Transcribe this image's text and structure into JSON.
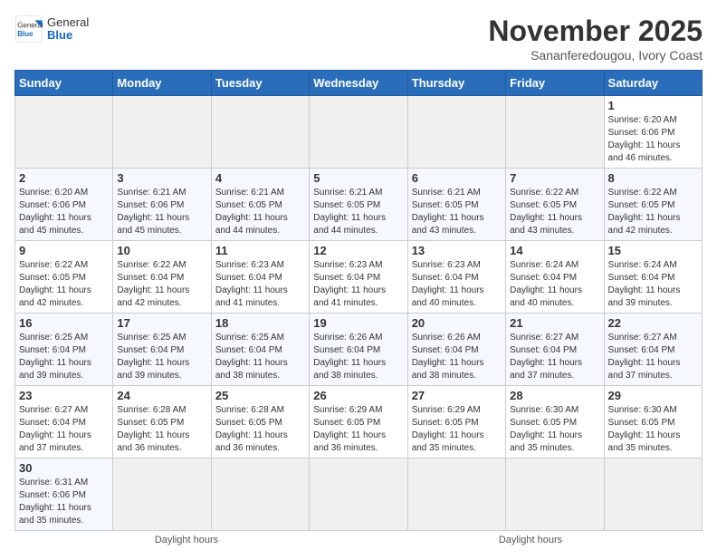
{
  "header": {
    "logo_general": "General",
    "logo_blue": "Blue",
    "month_title": "November 2025",
    "subtitle": "Sananferedougou, Ivory Coast"
  },
  "weekdays": [
    "Sunday",
    "Monday",
    "Tuesday",
    "Wednesday",
    "Thursday",
    "Friday",
    "Saturday"
  ],
  "weeks": [
    [
      {
        "day": "",
        "info": ""
      },
      {
        "day": "",
        "info": ""
      },
      {
        "day": "",
        "info": ""
      },
      {
        "day": "",
        "info": ""
      },
      {
        "day": "",
        "info": ""
      },
      {
        "day": "",
        "info": ""
      },
      {
        "day": "1",
        "info": "Sunrise: 6:20 AM\nSunset: 6:06 PM\nDaylight: 11 hours\nand 46 minutes."
      }
    ],
    [
      {
        "day": "2",
        "info": "Sunrise: 6:20 AM\nSunset: 6:06 PM\nDaylight: 11 hours\nand 45 minutes."
      },
      {
        "day": "3",
        "info": "Sunrise: 6:21 AM\nSunset: 6:06 PM\nDaylight: 11 hours\nand 45 minutes."
      },
      {
        "day": "4",
        "info": "Sunrise: 6:21 AM\nSunset: 6:05 PM\nDaylight: 11 hours\nand 44 minutes."
      },
      {
        "day": "5",
        "info": "Sunrise: 6:21 AM\nSunset: 6:05 PM\nDaylight: 11 hours\nand 44 minutes."
      },
      {
        "day": "6",
        "info": "Sunrise: 6:21 AM\nSunset: 6:05 PM\nDaylight: 11 hours\nand 43 minutes."
      },
      {
        "day": "7",
        "info": "Sunrise: 6:22 AM\nSunset: 6:05 PM\nDaylight: 11 hours\nand 43 minutes."
      },
      {
        "day": "8",
        "info": "Sunrise: 6:22 AM\nSunset: 6:05 PM\nDaylight: 11 hours\nand 42 minutes."
      }
    ],
    [
      {
        "day": "9",
        "info": "Sunrise: 6:22 AM\nSunset: 6:05 PM\nDaylight: 11 hours\nand 42 minutes."
      },
      {
        "day": "10",
        "info": "Sunrise: 6:22 AM\nSunset: 6:04 PM\nDaylight: 11 hours\nand 42 minutes."
      },
      {
        "day": "11",
        "info": "Sunrise: 6:23 AM\nSunset: 6:04 PM\nDaylight: 11 hours\nand 41 minutes."
      },
      {
        "day": "12",
        "info": "Sunrise: 6:23 AM\nSunset: 6:04 PM\nDaylight: 11 hours\nand 41 minutes."
      },
      {
        "day": "13",
        "info": "Sunrise: 6:23 AM\nSunset: 6:04 PM\nDaylight: 11 hours\nand 40 minutes."
      },
      {
        "day": "14",
        "info": "Sunrise: 6:24 AM\nSunset: 6:04 PM\nDaylight: 11 hours\nand 40 minutes."
      },
      {
        "day": "15",
        "info": "Sunrise: 6:24 AM\nSunset: 6:04 PM\nDaylight: 11 hours\nand 39 minutes."
      }
    ],
    [
      {
        "day": "16",
        "info": "Sunrise: 6:25 AM\nSunset: 6:04 PM\nDaylight: 11 hours\nand 39 minutes."
      },
      {
        "day": "17",
        "info": "Sunrise: 6:25 AM\nSunset: 6:04 PM\nDaylight: 11 hours\nand 39 minutes."
      },
      {
        "day": "18",
        "info": "Sunrise: 6:25 AM\nSunset: 6:04 PM\nDaylight: 11 hours\nand 38 minutes."
      },
      {
        "day": "19",
        "info": "Sunrise: 6:26 AM\nSunset: 6:04 PM\nDaylight: 11 hours\nand 38 minutes."
      },
      {
        "day": "20",
        "info": "Sunrise: 6:26 AM\nSunset: 6:04 PM\nDaylight: 11 hours\nand 38 minutes."
      },
      {
        "day": "21",
        "info": "Sunrise: 6:27 AM\nSunset: 6:04 PM\nDaylight: 11 hours\nand 37 minutes."
      },
      {
        "day": "22",
        "info": "Sunrise: 6:27 AM\nSunset: 6:04 PM\nDaylight: 11 hours\nand 37 minutes."
      }
    ],
    [
      {
        "day": "23",
        "info": "Sunrise: 6:27 AM\nSunset: 6:04 PM\nDaylight: 11 hours\nand 37 minutes."
      },
      {
        "day": "24",
        "info": "Sunrise: 6:28 AM\nSunset: 6:05 PM\nDaylight: 11 hours\nand 36 minutes."
      },
      {
        "day": "25",
        "info": "Sunrise: 6:28 AM\nSunset: 6:05 PM\nDaylight: 11 hours\nand 36 minutes."
      },
      {
        "day": "26",
        "info": "Sunrise: 6:29 AM\nSunset: 6:05 PM\nDaylight: 11 hours\nand 36 minutes."
      },
      {
        "day": "27",
        "info": "Sunrise: 6:29 AM\nSunset: 6:05 PM\nDaylight: 11 hours\nand 35 minutes."
      },
      {
        "day": "28",
        "info": "Sunrise: 6:30 AM\nSunset: 6:05 PM\nDaylight: 11 hours\nand 35 minutes."
      },
      {
        "day": "29",
        "info": "Sunrise: 6:30 AM\nSunset: 6:05 PM\nDaylight: 11 hours\nand 35 minutes."
      }
    ],
    [
      {
        "day": "30",
        "info": "Sunrise: 6:31 AM\nSunset: 6:06 PM\nDaylight: 11 hours\nand 35 minutes."
      },
      {
        "day": "",
        "info": ""
      },
      {
        "day": "",
        "info": ""
      },
      {
        "day": "",
        "info": ""
      },
      {
        "day": "",
        "info": ""
      },
      {
        "day": "",
        "info": ""
      },
      {
        "day": "",
        "info": ""
      }
    ]
  ],
  "footer": {
    "left_label": "Daylight hours",
    "right_label": "Daylight hours"
  }
}
